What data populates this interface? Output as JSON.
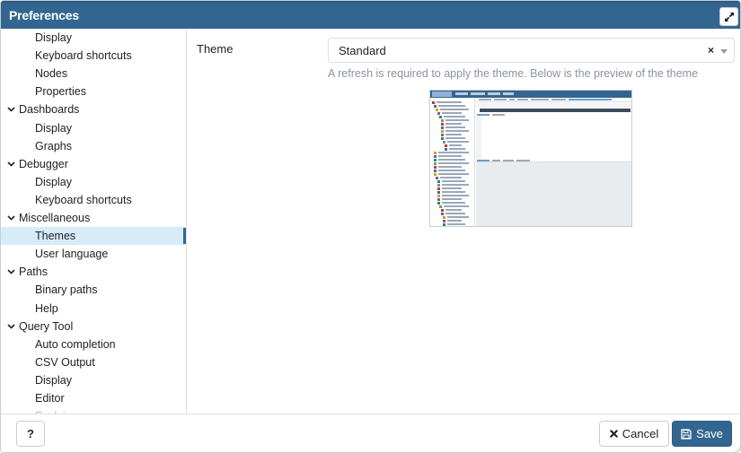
{
  "dialog": {
    "title": "Preferences",
    "maximize_icon": "expand-arrows-icon"
  },
  "sidebar": {
    "items": [
      {
        "type": "child",
        "label": "Display"
      },
      {
        "type": "child",
        "label": "Keyboard shortcuts"
      },
      {
        "type": "child",
        "label": "Nodes"
      },
      {
        "type": "child",
        "label": "Properties"
      },
      {
        "type": "group",
        "label": "Dashboards",
        "expanded": true
      },
      {
        "type": "child",
        "label": "Display"
      },
      {
        "type": "child",
        "label": "Graphs"
      },
      {
        "type": "group",
        "label": "Debugger",
        "expanded": true
      },
      {
        "type": "child",
        "label": "Display"
      },
      {
        "type": "child",
        "label": "Keyboard shortcuts"
      },
      {
        "type": "group",
        "label": "Miscellaneous",
        "expanded": true
      },
      {
        "type": "child",
        "label": "Themes",
        "selected": true
      },
      {
        "type": "child",
        "label": "User language"
      },
      {
        "type": "group",
        "label": "Paths",
        "expanded": true
      },
      {
        "type": "child",
        "label": "Binary paths"
      },
      {
        "type": "child",
        "label": "Help"
      },
      {
        "type": "group",
        "label": "Query Tool",
        "expanded": true
      },
      {
        "type": "child",
        "label": "Auto completion"
      },
      {
        "type": "child",
        "label": "CSV Output"
      },
      {
        "type": "child",
        "label": "Display"
      },
      {
        "type": "child",
        "label": "Editor"
      },
      {
        "type": "child",
        "label": "Explain",
        "partially_visible": true
      }
    ]
  },
  "content": {
    "theme_label": "Theme",
    "theme_value": "Standard",
    "clear_symbol": "×",
    "help_text": "A refresh is required to apply the theme. Below is the preview of the theme",
    "preview_alt": "Theme preview"
  },
  "footer": {
    "help_label": "?",
    "cancel_label": "Cancel",
    "save_label": "Save"
  },
  "colors": {
    "accent": "#326690",
    "selected_bg": "#d6ecf8",
    "help_text": "#8a93a0",
    "border": "#dde0e4"
  }
}
